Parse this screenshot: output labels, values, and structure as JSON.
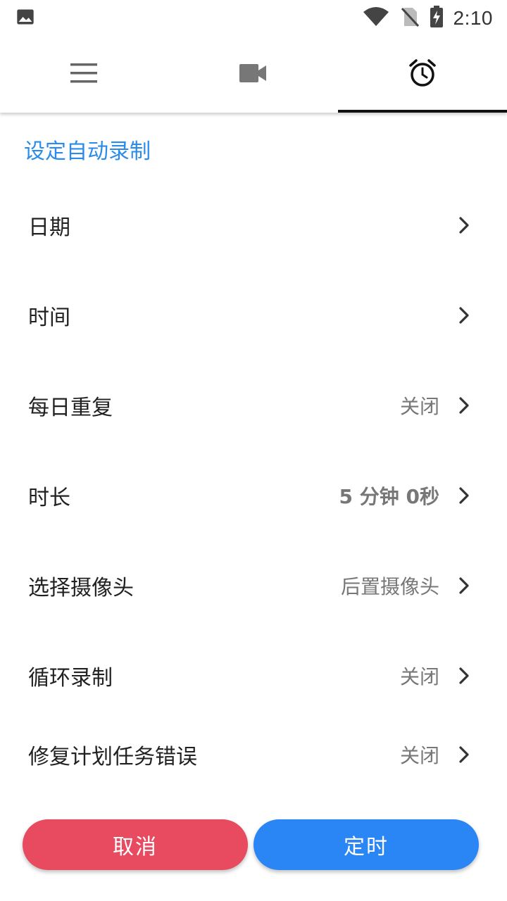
{
  "status_bar": {
    "time": "2:10",
    "icons": [
      "image-icon",
      "wifi-icon",
      "no-sim-icon",
      "battery-charging-icon"
    ]
  },
  "tabs": [
    {
      "icon": "menu-icon",
      "active": false
    },
    {
      "icon": "video-camera-icon",
      "active": false
    },
    {
      "icon": "alarm-clock-icon",
      "active": true
    }
  ],
  "section_title": "设定自动录制",
  "settings": [
    {
      "label": "日期",
      "value": ""
    },
    {
      "label": "时间",
      "value": ""
    },
    {
      "label": "每日重复",
      "value": "关闭"
    },
    {
      "label": "时长",
      "value": "5 分钟 0秒"
    },
    {
      "label": "选择摄像头",
      "value": "后置摄像头"
    },
    {
      "label": "循环录制",
      "value": "关闭"
    },
    {
      "label": "修复计划任务错误",
      "value": "关闭"
    }
  ],
  "buttons": {
    "cancel": "取消",
    "confirm": "定时"
  },
  "colors": {
    "accent": "#2a8be8",
    "cancel": "#e84a5f",
    "confirm": "#2b86f5"
  }
}
